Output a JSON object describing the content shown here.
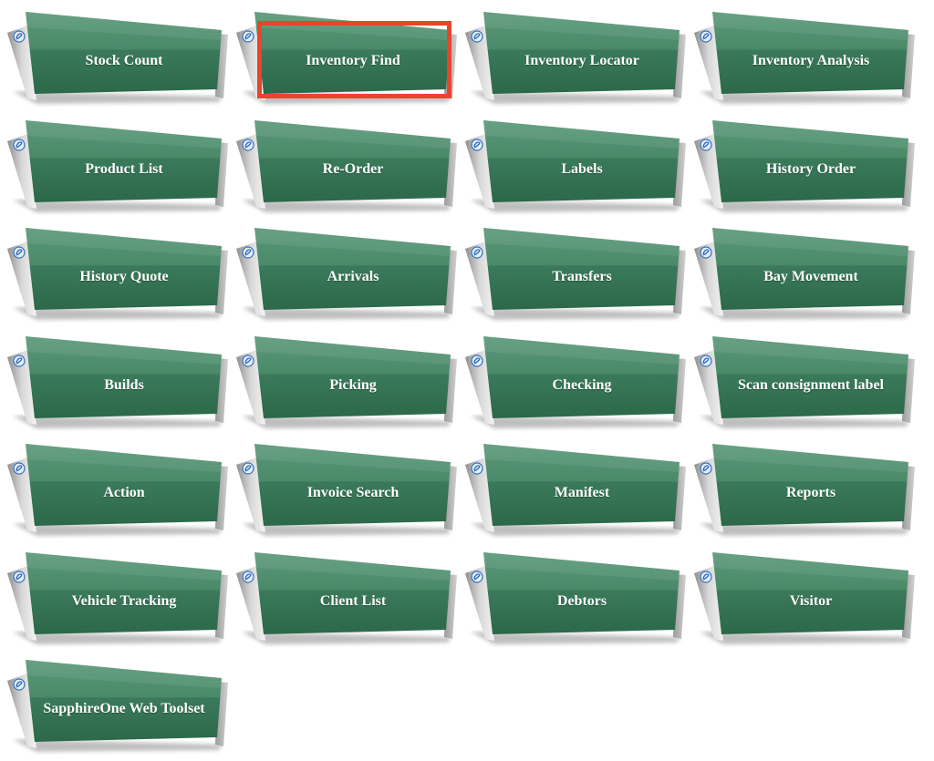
{
  "tiles": [
    {
      "label": "Stock Count"
    },
    {
      "label": "Inventory Find"
    },
    {
      "label": "Inventory Locator"
    },
    {
      "label": "Inventory Analysis"
    },
    {
      "label": "Product List"
    },
    {
      "label": "Re-Order"
    },
    {
      "label": "Labels"
    },
    {
      "label": "History Order"
    },
    {
      "label": "History Quote"
    },
    {
      "label": "Arrivals"
    },
    {
      "label": "Transfers"
    },
    {
      "label": "Bay Movement"
    },
    {
      "label": "Builds"
    },
    {
      "label": "Picking"
    },
    {
      "label": "Checking"
    },
    {
      "label": "Scan consignment label"
    },
    {
      "label": "Action"
    },
    {
      "label": "Invoice Search"
    },
    {
      "label": "Manifest"
    },
    {
      "label": "Reports"
    },
    {
      "label": "Vehicle Tracking"
    },
    {
      "label": "Client List"
    },
    {
      "label": "Debtors"
    },
    {
      "label": "Visitor"
    },
    {
      "label": "SapphireOne Web Toolset"
    }
  ],
  "highlighted_tile": "Inventory Find",
  "colors": {
    "tile_green_top": "#4f8d6e",
    "tile_green_bottom": "#2e6a4c",
    "tile_gray_backing": "#b9b9b9",
    "logo_blue": "#2f6fc4",
    "highlight_red": "#e8452c"
  }
}
